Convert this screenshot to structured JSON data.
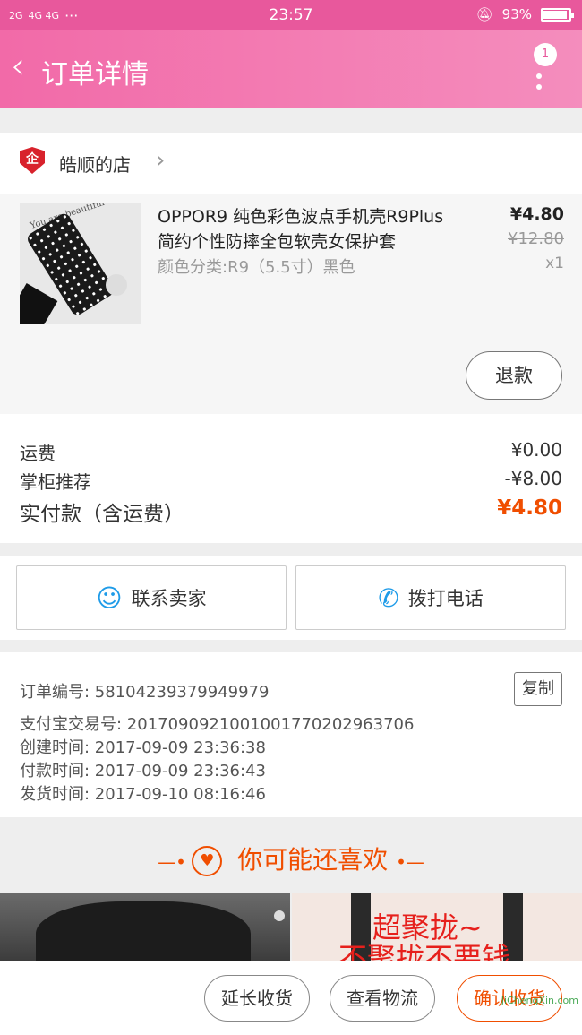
{
  "status_bar": {
    "signal_left": "2G",
    "signal_mid": "4G 4G",
    "more_dots": "···",
    "time": "23:57",
    "battery_percent": "93%",
    "battery_level": 0.93
  },
  "nav": {
    "back_glyph": "‹",
    "title": "订单详情",
    "badge": "1"
  },
  "shop": {
    "badge_char": "企",
    "name": "皓顺的店"
  },
  "item": {
    "thumb_text": "You are beautiful",
    "title": "OPPOR9 纯色彩色波点手机壳R9Plus 简约个性防摔全包软壳女保护套",
    "spec": "颜色分类:R9（5.5寸）黑色",
    "price": "¥4.80",
    "original_price": "¥12.80",
    "quantity": "x1",
    "refund_label": "退款"
  },
  "costs": {
    "shipping_label": "运费",
    "shipping_value": "¥0.00",
    "recommend_label": "掌柜推荐",
    "recommend_value": "-¥8.00",
    "total_label": "实付款（含运费）",
    "total_value": "¥4.80"
  },
  "contact": {
    "seller_label": "联系卖家",
    "call_label": "拨打电话"
  },
  "order_info": {
    "order_no": "订单编号: 58104239379949979",
    "copy_label": "复制",
    "alipay_no": "支付宝交易号: 2017090921001001770202963706",
    "created": "创建时间: 2017-09-09 23:36:38",
    "paid": "付款时间: 2017-09-09 23:36:43",
    "shipped": "发货时间: 2017-09-10 08:16:46"
  },
  "recommend": {
    "title": "你可能还喜欢",
    "ad_line1": "超聚拢~",
    "ad_line2": "不聚拢不要钱"
  },
  "bottom_bar": {
    "extend_label": "延长收货",
    "logistics_label": "查看物流",
    "confirm_label": "确认收货",
    "watermark": "JiChengXin.com"
  }
}
